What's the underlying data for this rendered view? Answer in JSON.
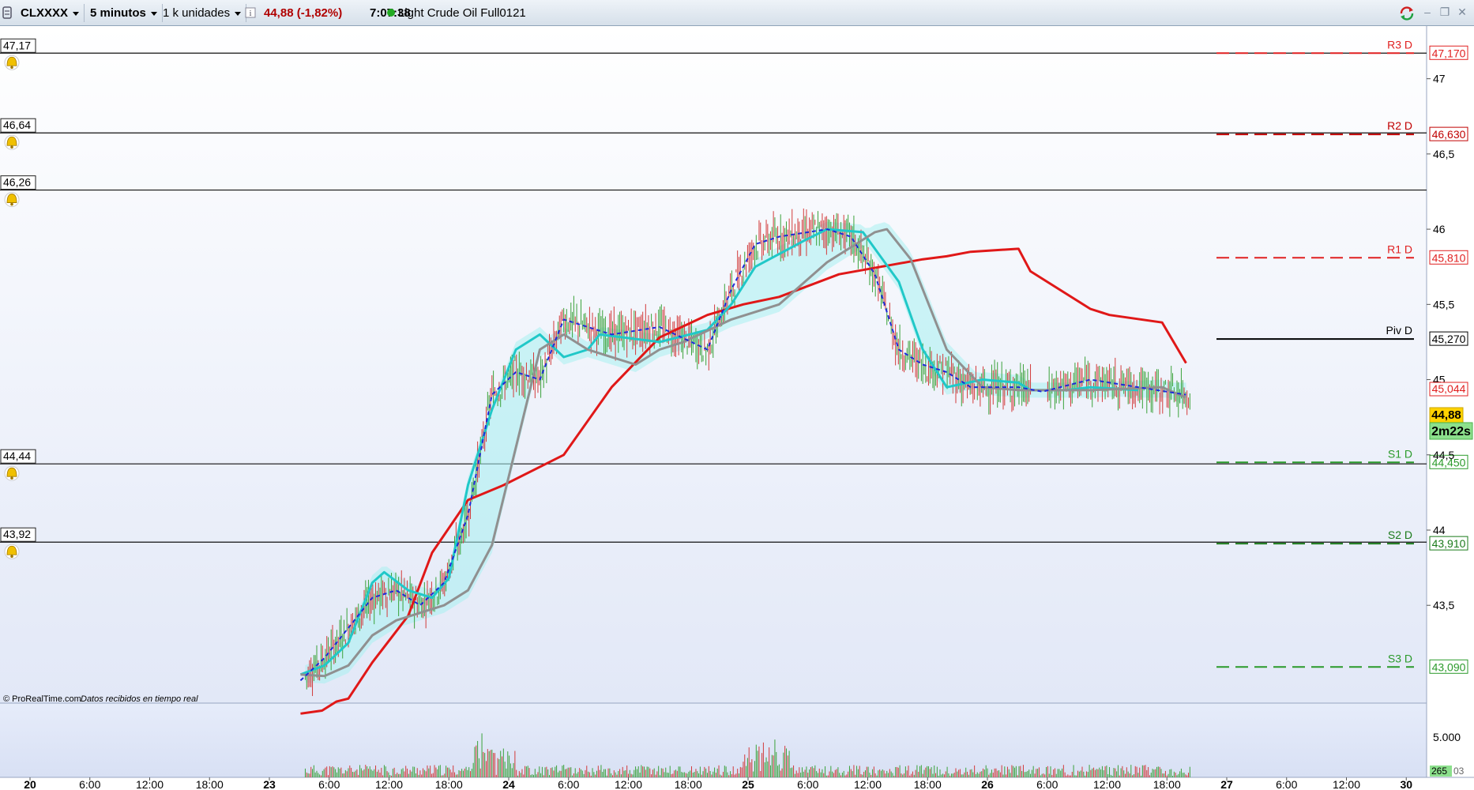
{
  "toolbar": {
    "symbol": "CLXXXX",
    "timeframe": "5 minutos",
    "units": "1 k unidades",
    "info_icon": "info-icon",
    "price_change": "44,88 (-1,82%)",
    "time": "7:07:38",
    "status_dot_color": "#22aa22",
    "instrument": "Light Crude Oil Full0121"
  },
  "footer": {
    "copyright": "© ProRealTime.com",
    "realtime": "Datos recibidos en tiempo real"
  },
  "countdown": "2m22s",
  "chart_data": {
    "type": "line",
    "x_labels": [
      "20",
      "6:00",
      "12:00",
      "18:00",
      "23",
      "6:00",
      "12:00",
      "18:00",
      "24",
      "6:00",
      "12:00",
      "18:00",
      "25",
      "6:00",
      "12:00",
      "18:00",
      "26",
      "6:00",
      "12:00",
      "18:00",
      "27",
      "6:00",
      "12:00",
      "30"
    ],
    "y_ticks": [
      "47",
      "46,5",
      "46",
      "45,5",
      "45",
      "44,5",
      "44",
      "43,5"
    ],
    "y_tick_values": [
      47,
      46.5,
      46,
      45.5,
      45,
      44.5,
      44,
      43.5
    ],
    "ylim": [
      42.85,
      47.35
    ],
    "last_price": "44,88",
    "ma_value_label": "45,044",
    "alert_lines": [
      {
        "label": "47,17",
        "value": 47.17
      },
      {
        "label": "46,64",
        "value": 46.64
      },
      {
        "label": "46,26",
        "value": 46.26
      },
      {
        "label": "44,44",
        "value": 44.44
      },
      {
        "label": "43,92",
        "value": 43.92
      }
    ],
    "pivot_levels": [
      {
        "name": "R3 D",
        "label": "47,170",
        "value": 47.17,
        "color": "#e02020"
      },
      {
        "name": "R2 D",
        "label": "46,630",
        "value": 46.63,
        "color": "#c00000"
      },
      {
        "name": "R1 D",
        "label": "45,810",
        "value": 45.81,
        "color": "#e02020"
      },
      {
        "name": "Piv D",
        "label": "45,270",
        "value": 45.27,
        "color": "#000000"
      },
      {
        "name": "S1 D",
        "label": "44,450",
        "value": 44.45,
        "color": "#2a9a2a"
      },
      {
        "name": "S2 D",
        "label": "43,910",
        "value": 43.91,
        "color": "#1a7a1a"
      },
      {
        "name": "S3 D",
        "label": "43,090",
        "value": 43.09,
        "color": "#2a9a2a"
      }
    ],
    "series": [
      {
        "color": "#e01818",
        "style": "solid",
        "points": [
          [
            0.0,
            42.78
          ],
          [
            0.09,
            42.8
          ],
          [
            0.15,
            42.86
          ],
          [
            0.2,
            42.88
          ],
          [
            0.3,
            43.12
          ],
          [
            0.45,
            43.43
          ],
          [
            0.55,
            43.85
          ],
          [
            0.7,
            44.2
          ],
          [
            0.85,
            44.3
          ],
          [
            1.1,
            44.5
          ],
          [
            1.3,
            44.95
          ],
          [
            1.5,
            45.28
          ],
          [
            1.7,
            45.43
          ],
          [
            1.85,
            45.5
          ],
          [
            2.0,
            45.55
          ],
          [
            2.25,
            45.7
          ],
          [
            2.6,
            45.8
          ],
          [
            2.7,
            45.82
          ],
          [
            2.8,
            45.85
          ],
          [
            3.0,
            45.87
          ],
          [
            3.05,
            45.72
          ],
          [
            3.3,
            45.47
          ],
          [
            3.38,
            45.43
          ],
          [
            3.6,
            45.38
          ],
          [
            3.7,
            45.11
          ]
        ]
      },
      {
        "color": "#20c8c8",
        "style": "solid",
        "points": [
          [
            0.0,
            43.04
          ],
          [
            0.1,
            43.1
          ],
          [
            0.2,
            43.25
          ],
          [
            0.25,
            43.45
          ],
          [
            0.3,
            43.65
          ],
          [
            0.35,
            43.72
          ],
          [
            0.45,
            43.6
          ],
          [
            0.55,
            43.55
          ],
          [
            0.62,
            43.68
          ],
          [
            0.7,
            44.3
          ],
          [
            0.8,
            44.8
          ],
          [
            0.9,
            45.2
          ],
          [
            1.0,
            45.3
          ],
          [
            1.1,
            45.15
          ],
          [
            1.2,
            45.2
          ],
          [
            1.25,
            45.3
          ],
          [
            1.5,
            45.25
          ],
          [
            1.7,
            45.33
          ],
          [
            1.8,
            45.5
          ],
          [
            1.9,
            45.75
          ],
          [
            2.1,
            45.92
          ],
          [
            2.2,
            46.0
          ],
          [
            2.35,
            45.98
          ],
          [
            2.5,
            45.65
          ],
          [
            2.6,
            45.2
          ],
          [
            2.7,
            44.95
          ],
          [
            2.85,
            45.0
          ],
          [
            3.0,
            44.98
          ],
          [
            3.05,
            44.93
          ],
          [
            3.2,
            44.93
          ],
          [
            3.3,
            44.95
          ],
          [
            3.5,
            44.93
          ]
        ]
      },
      {
        "color": "#909090",
        "style": "solid",
        "points": [
          [
            0.0,
            43.04
          ],
          [
            0.1,
            43.03
          ],
          [
            0.2,
            43.1
          ],
          [
            0.3,
            43.3
          ],
          [
            0.4,
            43.4
          ],
          [
            0.5,
            43.45
          ],
          [
            0.6,
            43.5
          ],
          [
            0.7,
            43.6
          ],
          [
            0.8,
            43.9
          ],
          [
            1.0,
            45.2
          ],
          [
            1.1,
            45.3
          ],
          [
            1.2,
            45.2
          ],
          [
            1.4,
            45.1
          ],
          [
            1.5,
            45.2
          ],
          [
            1.6,
            45.25
          ],
          [
            1.8,
            45.4
          ],
          [
            2.0,
            45.5
          ],
          [
            2.2,
            45.78
          ],
          [
            2.4,
            45.98
          ],
          [
            2.45,
            46.0
          ],
          [
            2.55,
            45.8
          ],
          [
            2.7,
            45.2
          ],
          [
            2.85,
            44.95
          ],
          [
            3.0,
            44.93
          ],
          [
            3.3,
            44.93
          ],
          [
            3.6,
            44.95
          ],
          [
            3.7,
            44.88
          ]
        ]
      },
      {
        "color": "#1e2ad8",
        "style": "dashed",
        "points": [
          [
            0.0,
            43.0
          ],
          [
            0.1,
            43.15
          ],
          [
            0.2,
            43.35
          ],
          [
            0.3,
            43.55
          ],
          [
            0.4,
            43.6
          ],
          [
            0.5,
            43.5
          ],
          [
            0.6,
            43.65
          ],
          [
            0.7,
            44.1
          ],
          [
            0.8,
            44.9
          ],
          [
            0.9,
            45.05
          ],
          [
            1.0,
            45.0
          ],
          [
            1.1,
            45.4
          ],
          [
            1.2,
            45.35
          ],
          [
            1.3,
            45.3
          ],
          [
            1.5,
            45.35
          ],
          [
            1.7,
            45.2
          ],
          [
            1.8,
            45.6
          ],
          [
            1.9,
            45.9
          ],
          [
            2.0,
            45.95
          ],
          [
            2.2,
            46.0
          ],
          [
            2.3,
            45.95
          ],
          [
            2.4,
            45.7
          ],
          [
            2.5,
            45.2
          ],
          [
            2.6,
            45.1
          ],
          [
            2.7,
            45.05
          ],
          [
            2.8,
            44.95
          ],
          [
            3.0,
            44.95
          ],
          [
            3.1,
            44.92
          ],
          [
            3.3,
            45.0
          ],
          [
            3.5,
            44.95
          ],
          [
            3.7,
            44.9
          ]
        ]
      }
    ],
    "volume": {
      "ticks": [
        "5.000"
      ],
      "last": "265",
      "avg_label": "03"
    }
  }
}
